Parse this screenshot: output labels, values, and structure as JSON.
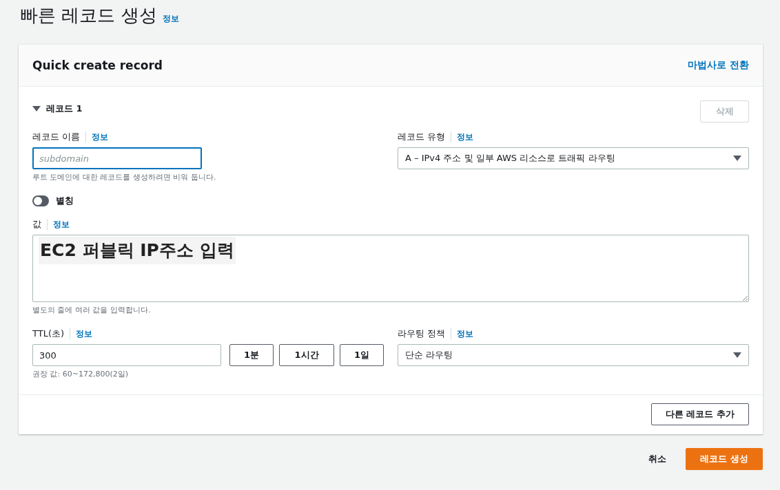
{
  "page": {
    "title": "빠른 레코드 생성",
    "info": "정보"
  },
  "card": {
    "title": "Quick create record",
    "wizard_link": "마법사로 전환"
  },
  "record": {
    "title": "레코드 1",
    "expanded": true,
    "delete_button": "삭제",
    "delete_disabled": true,
    "name": {
      "label": "레코드 이름",
      "info": "정보",
      "placeholder": "subdomain",
      "hint": "루트 도메인에 대한 레코드를 생성하려면 비워 둡니다."
    },
    "type": {
      "label": "레코드 유형",
      "info": "정보",
      "value": "A – IPv4 주소 및 일부 AWS 리소스로 트래픽 라우팅"
    },
    "alias": {
      "label": "별칭",
      "on": false
    },
    "value": {
      "label": "값",
      "info": "정보",
      "annotation": "EC2 퍼블릭 IP주소 입력",
      "hint": "별도의 줄에 여러 값을 입력합니다."
    },
    "ttl": {
      "label": "TTL(초)",
      "info": "정보",
      "value": "300",
      "presets": [
        "1분",
        "1시간",
        "1일"
      ],
      "hint": "권장 값: 60~172,800(2일)"
    },
    "routing": {
      "label": "라우팅 정책",
      "info": "정보",
      "value": "단순 라우팅"
    }
  },
  "add_button": "다른 레코드 추가",
  "actions": {
    "cancel": "취소",
    "submit": "레코드 생성"
  }
}
